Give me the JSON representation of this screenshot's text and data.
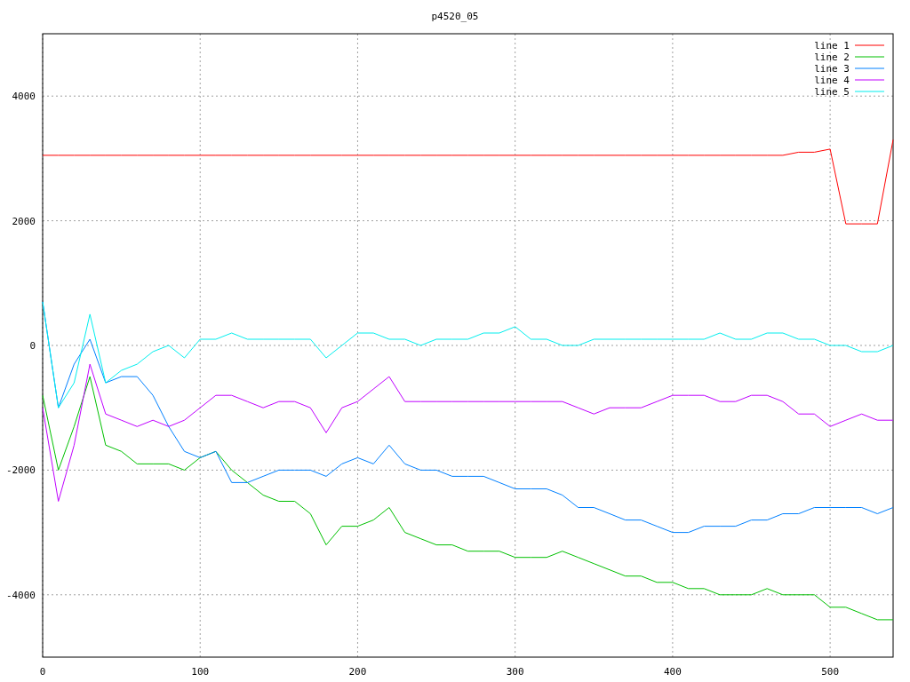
{
  "chart_data": {
    "type": "line",
    "title": "p4520_05",
    "x": [
      0,
      10,
      20,
      30,
      40,
      50,
      60,
      70,
      80,
      90,
      100,
      110,
      120,
      130,
      140,
      150,
      160,
      170,
      180,
      190,
      200,
      210,
      220,
      230,
      240,
      250,
      260,
      270,
      280,
      290,
      300,
      310,
      320,
      330,
      340,
      350,
      360,
      370,
      380,
      390,
      400,
      410,
      420,
      430,
      440,
      450,
      460,
      470,
      480,
      490,
      500,
      510,
      520,
      530,
      540
    ],
    "series": [
      {
        "name": "line 1",
        "color": "#ff0000",
        "values": [
          3050,
          3050,
          3050,
          3050,
          3050,
          3050,
          3050,
          3050,
          3050,
          3050,
          3050,
          3050,
          3050,
          3050,
          3050,
          3050,
          3050,
          3050,
          3050,
          3050,
          3050,
          3050,
          3050,
          3050,
          3050,
          3050,
          3050,
          3050,
          3050,
          3050,
          3050,
          3050,
          3050,
          3050,
          3050,
          3050,
          3050,
          3050,
          3050,
          3050,
          3050,
          3050,
          3050,
          3050,
          3050,
          3050,
          3050,
          3050,
          3100,
          3100,
          3150,
          1950,
          1950,
          1950,
          3300
        ]
      },
      {
        "name": "line 2",
        "color": "#00c000",
        "values": [
          -800,
          -2000,
          -1300,
          -500,
          -1600,
          -1700,
          -1900,
          -1900,
          -1900,
          -2000,
          -1800,
          -1700,
          -2000,
          -2200,
          -2400,
          -2500,
          -2500,
          -2700,
          -3200,
          -2900,
          -2900,
          -2800,
          -2600,
          -3000,
          -3100,
          -3200,
          -3200,
          -3300,
          -3300,
          -3300,
          -3400,
          -3400,
          -3400,
          -3300,
          -3400,
          -3500,
          -3600,
          -3700,
          -3700,
          -3800,
          -3800,
          -3900,
          -3900,
          -4000,
          -4000,
          -4000,
          -3900,
          -4000,
          -4000,
          -4000,
          -4200,
          -4200,
          -4300,
          -4400,
          -4400
        ]
      },
      {
        "name": "line 3",
        "color": "#0080ff",
        "values": [
          700,
          -1000,
          -300,
          100,
          -600,
          -500,
          -500,
          -800,
          -1300,
          -1700,
          -1800,
          -1700,
          -2200,
          -2200,
          -2100,
          -2000,
          -2000,
          -2000,
          -2100,
          -1900,
          -1800,
          -1900,
          -1600,
          -1900,
          -2000,
          -2000,
          -2100,
          -2100,
          -2100,
          -2200,
          -2300,
          -2300,
          -2300,
          -2400,
          -2600,
          -2600,
          -2700,
          -2800,
          -2800,
          -2900,
          -3000,
          -3000,
          -2900,
          -2900,
          -2900,
          -2800,
          -2800,
          -2700,
          -2700,
          -2600,
          -2600,
          -2600,
          -2600,
          -2700,
          -2600
        ]
      },
      {
        "name": "line 4",
        "color": "#c000ff",
        "values": [
          -1000,
          -2500,
          -1600,
          -300,
          -1100,
          -1200,
          -1300,
          -1200,
          -1300,
          -1200,
          -1000,
          -800,
          -800,
          -900,
          -1000,
          -900,
          -900,
          -1000,
          -1400,
          -1000,
          -900,
          -700,
          -500,
          -900,
          -900,
          -900,
          -900,
          -900,
          -900,
          -900,
          -900,
          -900,
          -900,
          -900,
          -1000,
          -1100,
          -1000,
          -1000,
          -1000,
          -900,
          -800,
          -800,
          -800,
          -900,
          -900,
          -800,
          -800,
          -900,
          -1100,
          -1100,
          -1300,
          -1200,
          -1100,
          -1200,
          -1200
        ]
      },
      {
        "name": "line 5",
        "color": "#00eeee",
        "values": [
          700,
          -1000,
          -600,
          500,
          -600,
          -400,
          -300,
          -100,
          0,
          -200,
          100,
          100,
          200,
          100,
          100,
          100,
          100,
          100,
          -200,
          0,
          200,
          200,
          100,
          100,
          0,
          100,
          100,
          100,
          200,
          200,
          300,
          100,
          100,
          0,
          0,
          100,
          100,
          100,
          100,
          100,
          100,
          100,
          100,
          200,
          100,
          100,
          200,
          200,
          100,
          100,
          0,
          0,
          -100,
          -100,
          0
        ]
      }
    ],
    "xlim": [
      0,
      540
    ],
    "ylim": [
      -5000,
      5000
    ],
    "xticks": [
      0,
      100,
      200,
      300,
      400,
      500
    ],
    "yticks": [
      -4000,
      -2000,
      0,
      2000,
      4000
    ],
    "grid": true,
    "legend": true
  }
}
